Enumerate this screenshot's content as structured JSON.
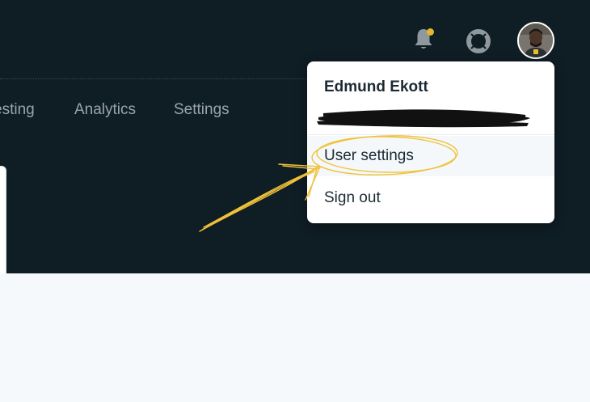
{
  "nav": {
    "items": [
      {
        "label": "esting"
      },
      {
        "label": "Analytics"
      },
      {
        "label": "Settings"
      }
    ]
  },
  "header": {
    "notification_icon": "bell-icon",
    "notification_badge_color": "#e3b531",
    "help_icon": "lifebuoy-icon",
    "avatar_icon": "user-avatar"
  },
  "user_menu": {
    "name": "Edmund Ekott",
    "items": [
      {
        "label": "User settings"
      },
      {
        "label": "Sign out"
      }
    ]
  },
  "colors": {
    "header_bg": "#0f1d24",
    "content_bg": "#f6f9fb",
    "annotation": "#f0c23b"
  }
}
